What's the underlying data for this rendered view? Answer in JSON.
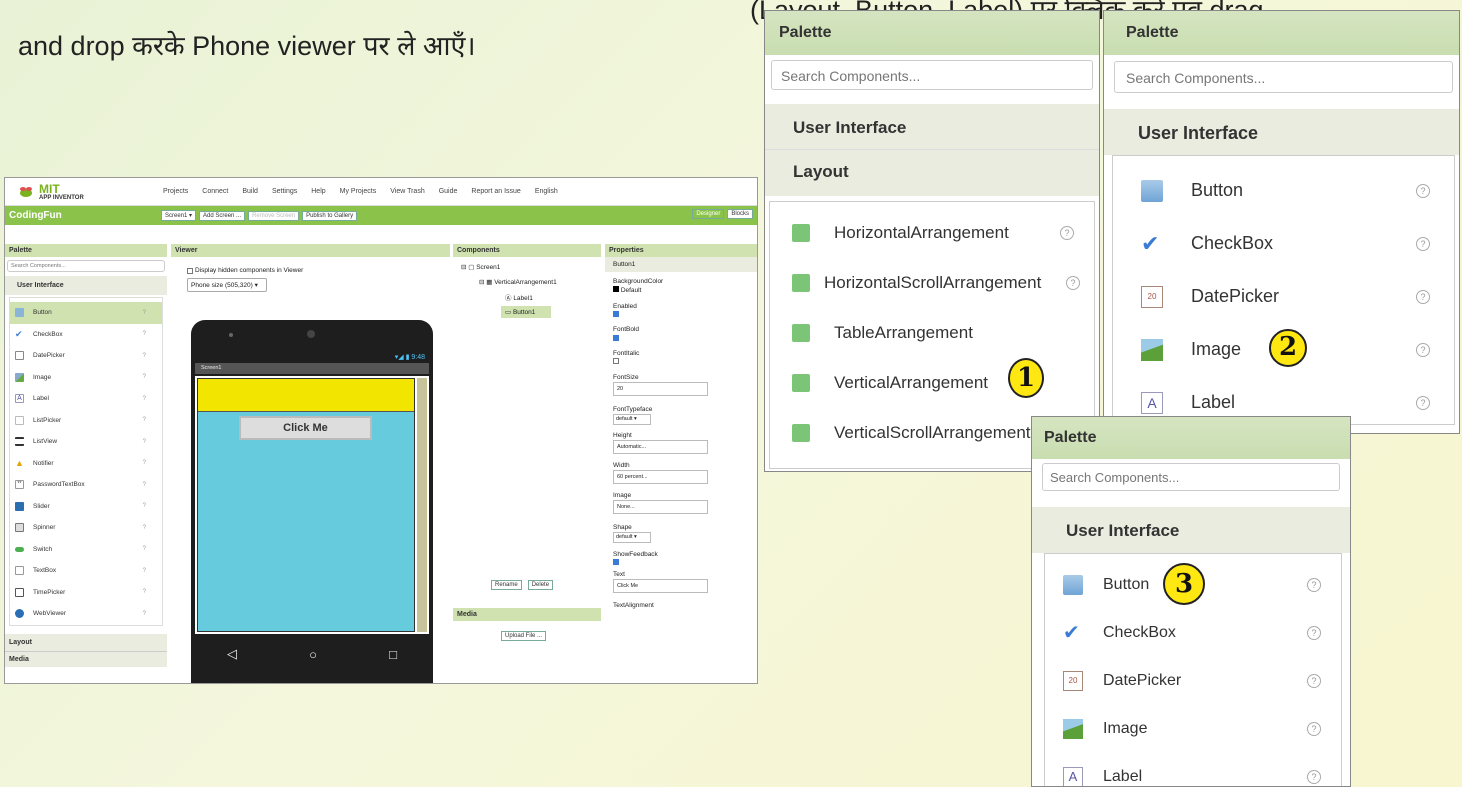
{
  "caption": {
    "text": "and drop करके Phone viewer पर ले आएँ।",
    "top_fragment": "(Layout, Button, Label) पर क्लिक करें एवं drag"
  },
  "mit": {
    "logo": {
      "mit": "MIT",
      "sub": "APP INVENTOR"
    },
    "menu": [
      "Projects",
      "Connect",
      "Build",
      "Settings",
      "Help",
      "My Projects",
      "View Trash",
      "Guide",
      "Report an Issue",
      "English"
    ],
    "project_name": "CodingFun",
    "toolbar": {
      "screen": "Screen1 ▾",
      "add_screen": "Add Screen ...",
      "remove_screen": "Remove Screen",
      "publish": "Publish to Gallery",
      "designer": "Designer",
      "blocks": "Blocks"
    },
    "palette": {
      "title": "Palette",
      "search_placeholder": "Search Components...",
      "section": "User Interface",
      "items": [
        "Button",
        "CheckBox",
        "DatePicker",
        "Image",
        "Label",
        "ListPicker",
        "ListView",
        "Notifier",
        "PasswordTextBox",
        "Slider",
        "Spinner",
        "Switch",
        "TextBox",
        "TimePicker",
        "WebViewer"
      ],
      "footer": [
        "Layout",
        "Media"
      ]
    },
    "viewer": {
      "title": "Viewer",
      "checkbox_label": "Display hidden components in Viewer",
      "phone_size": "Phone size (505,320)",
      "time": "9:48",
      "screen_title": "Screen1",
      "button_text": "Click Me"
    },
    "components": {
      "title": "Components",
      "tree": [
        "Screen1",
        "VerticalArrangement1",
        "Label1",
        "Button1"
      ],
      "rename": "Rename",
      "delete": "Delete",
      "media_title": "Media",
      "upload": "Upload File ..."
    },
    "properties": {
      "title": "Properties",
      "selected": "Button1",
      "bg_label": "BackgroundColor",
      "bg_value": "Default",
      "enabled": "Enabled",
      "fontbold": "FontBold",
      "fontitalic": "FontItalic",
      "fontsize": "FontSize",
      "fontsize_value": "20",
      "typeface": "FontTypeface",
      "typeface_value": "default ▾",
      "height": "Height",
      "height_value": "Automatic...",
      "width": "Width",
      "width_value": "60 percent...",
      "image": "Image",
      "image_value": "None...",
      "shape": "Shape",
      "shape_value": "default ▾",
      "showfeedback": "ShowFeedback",
      "text": "Text",
      "text_value": "Click Me",
      "textalign": "TextAlignment"
    }
  },
  "panel1": {
    "title": "Palette",
    "search_placeholder": "Search Components...",
    "section": "User Interface",
    "section2": "Layout",
    "items": [
      "HorizontalArrangement",
      "HorizontalScrollArrangement",
      "TableArrangement",
      "VerticalArrangement",
      "VerticalScrollArrangement"
    ],
    "marker": "1"
  },
  "panel2": {
    "title": "Palette",
    "search_placeholder": "Search Components...",
    "section": "User Interface",
    "items": [
      "Button",
      "CheckBox",
      "DatePicker",
      "Image",
      "Label"
    ],
    "marker": "2"
  },
  "panel3": {
    "title": "Palette",
    "search_placeholder": "Search Components...",
    "section": "User Interface",
    "items": [
      "Button",
      "CheckBox",
      "DatePicker",
      "Image",
      "Label"
    ],
    "marker": "3"
  },
  "colors": {
    "accent": "#8bc34a",
    "header": "#cfe2b0",
    "phone_screen": "#66ccdd",
    "phone_yellow": "#f2e600",
    "marker": "#ffe811"
  }
}
